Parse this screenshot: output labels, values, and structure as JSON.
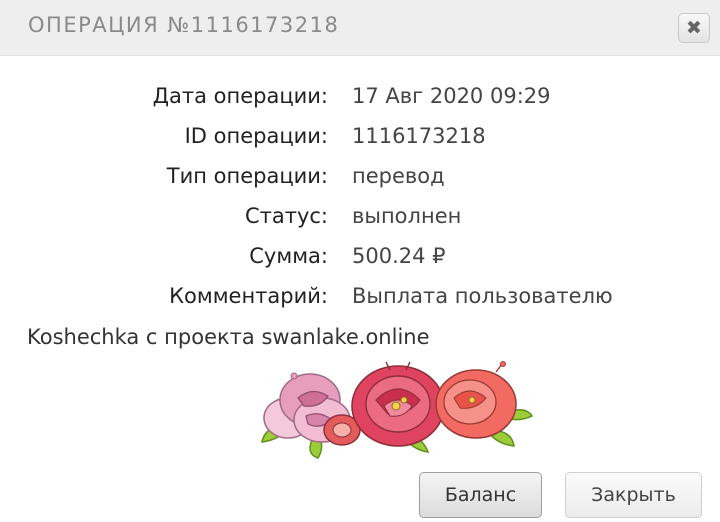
{
  "dialog": {
    "title": "ОПЕРАЦИЯ №1116173218",
    "close_icon": "✖"
  },
  "details": [
    {
      "label": "Дата операции:",
      "value": "17 Авг 2020 09:29"
    },
    {
      "label": "ID операции:",
      "value": "1116173218"
    },
    {
      "label": "Тип операции:",
      "value": "перевод"
    },
    {
      "label": "Статус:",
      "value": "выполнен"
    },
    {
      "label": "Сумма:",
      "value": "500.24 ₽"
    },
    {
      "label": "Комментарий:",
      "value": "Выплата пользователю"
    }
  ],
  "comment": "Koshechka с проекта swanlake.online",
  "buttons": {
    "balance": "Баланс",
    "close": "Закрыть"
  },
  "colors": {
    "header_bg": "#eeeeee",
    "title": "#8a8a8a",
    "flower_pink": "#e07aa0",
    "flower_red": "#e0435f",
    "flower_coral": "#f26a62",
    "leaf": "#9ccc3a"
  }
}
